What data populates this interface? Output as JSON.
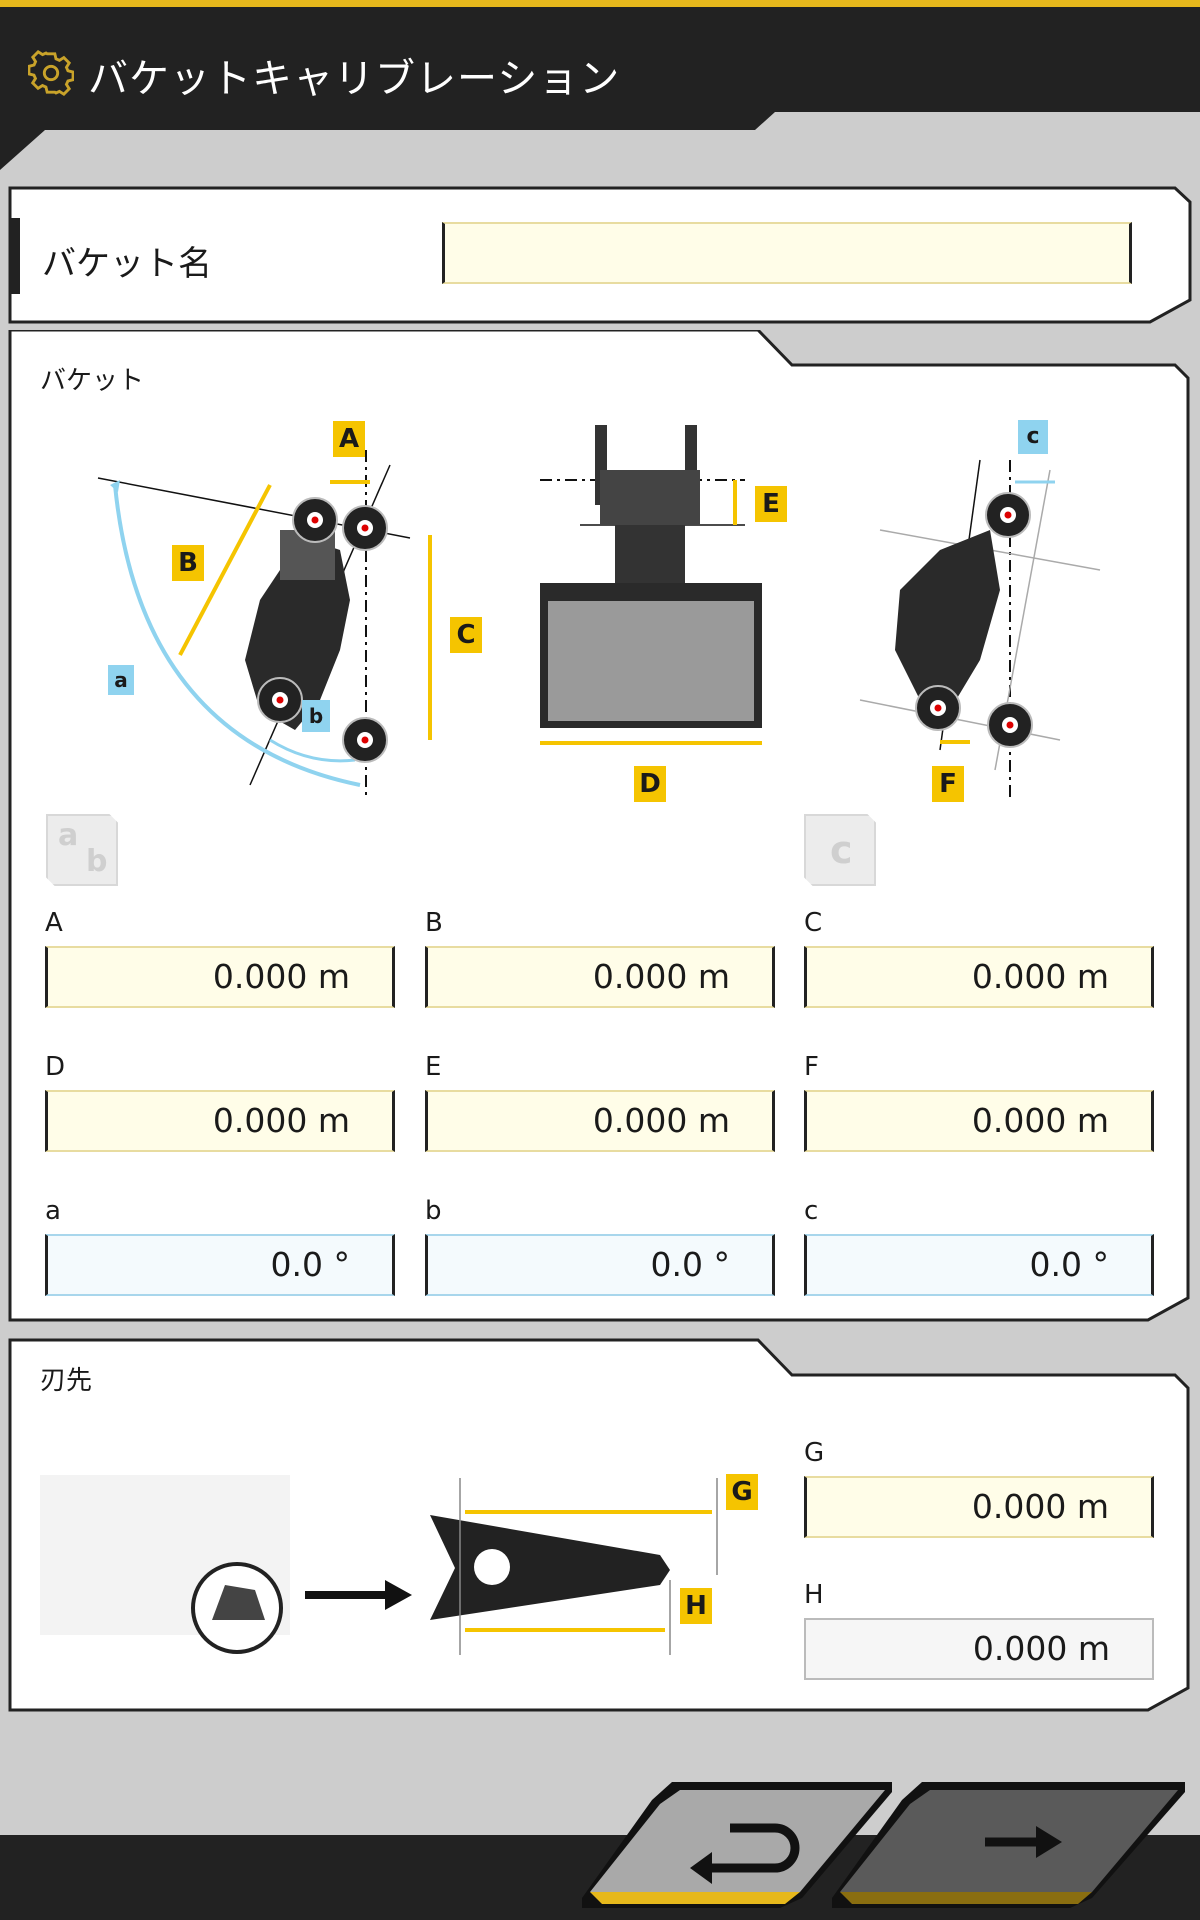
{
  "header": {
    "title": "バケットキャリブレーション",
    "icon": "gear-icon",
    "accent": "#e6b81c"
  },
  "bucket_name": {
    "label": "バケット名",
    "value": ""
  },
  "bucket_section": {
    "title": "バケット",
    "diagram_labels": {
      "A": "A",
      "B": "B",
      "C": "C",
      "D": "D",
      "E": "E",
      "F": "F",
      "a": "a",
      "b": "b",
      "c": "c"
    },
    "toggle_ab": {
      "top": "a",
      "bottom": "b"
    },
    "toggle_c": "c",
    "fields": [
      {
        "label": "A",
        "value": "0.000 m"
      },
      {
        "label": "B",
        "value": "0.000 m"
      },
      {
        "label": "C",
        "value": "0.000 m"
      },
      {
        "label": "D",
        "value": "0.000 m"
      },
      {
        "label": "E",
        "value": "0.000 m"
      },
      {
        "label": "F",
        "value": "0.000 m"
      },
      {
        "label": "a",
        "value": "0.0 °"
      },
      {
        "label": "b",
        "value": "0.0 °"
      },
      {
        "label": "c",
        "value": "0.0 °"
      }
    ]
  },
  "tip_section": {
    "title": "刃先",
    "diagram_labels": {
      "G": "G",
      "H": "H"
    },
    "fields": [
      {
        "label": "G",
        "value": "0.000 m"
      },
      {
        "label": "H",
        "value": "0.000 m"
      }
    ]
  },
  "footer": {
    "back_icon": "return-arrow-icon",
    "next_icon": "right-arrow-icon"
  },
  "colors": {
    "yellow_tag": "#f5c400",
    "blue_tag": "#8fd3ef",
    "field_yellow": "#fffde8",
    "field_blue": "#f4fafd",
    "dark": "#222222"
  }
}
